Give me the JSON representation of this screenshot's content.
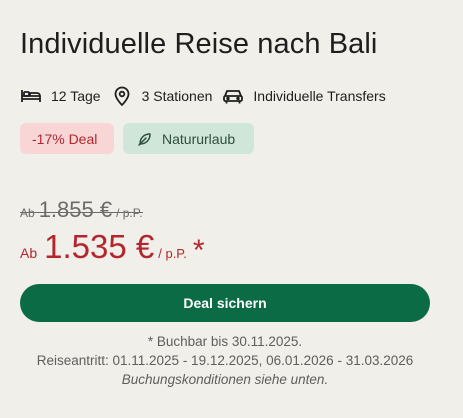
{
  "title": "Individuelle Reise nach Bali",
  "facts": [
    {
      "icon": "bed-icon",
      "label": "12 Tage"
    },
    {
      "icon": "map-pin-icon",
      "label": "3 Stationen"
    },
    {
      "icon": "car-icon",
      "label": "Individuelle Transfers"
    }
  ],
  "badges": {
    "deal": "-17% Deal",
    "nature": "Natururlaub",
    "nature_icon": "leaf-icon"
  },
  "price": {
    "old_prefix": "Ab",
    "old_amount": "1.855 €",
    "old_suffix": "/ p.P.",
    "new_prefix": "Ab",
    "new_amount": "1.535 €",
    "new_suffix": "/ p.P.",
    "asterisk": "*"
  },
  "cta_label": "Deal sichern",
  "notes": {
    "bookable": "* Buchbar bis 30.11.2025.",
    "travel_dates": "Reiseantritt: 01.11.2025 - 19.12.2025, 06.01.2026 - 31.03.2026",
    "conditions": "Buchungskonditionen siehe unten."
  },
  "colors": {
    "background": "#f1efe9",
    "accent_green": "#0a6b45",
    "price_red": "#b3262d",
    "deal_badge_bg": "#f8d6d6",
    "nature_badge_bg": "#cfe6d8"
  }
}
